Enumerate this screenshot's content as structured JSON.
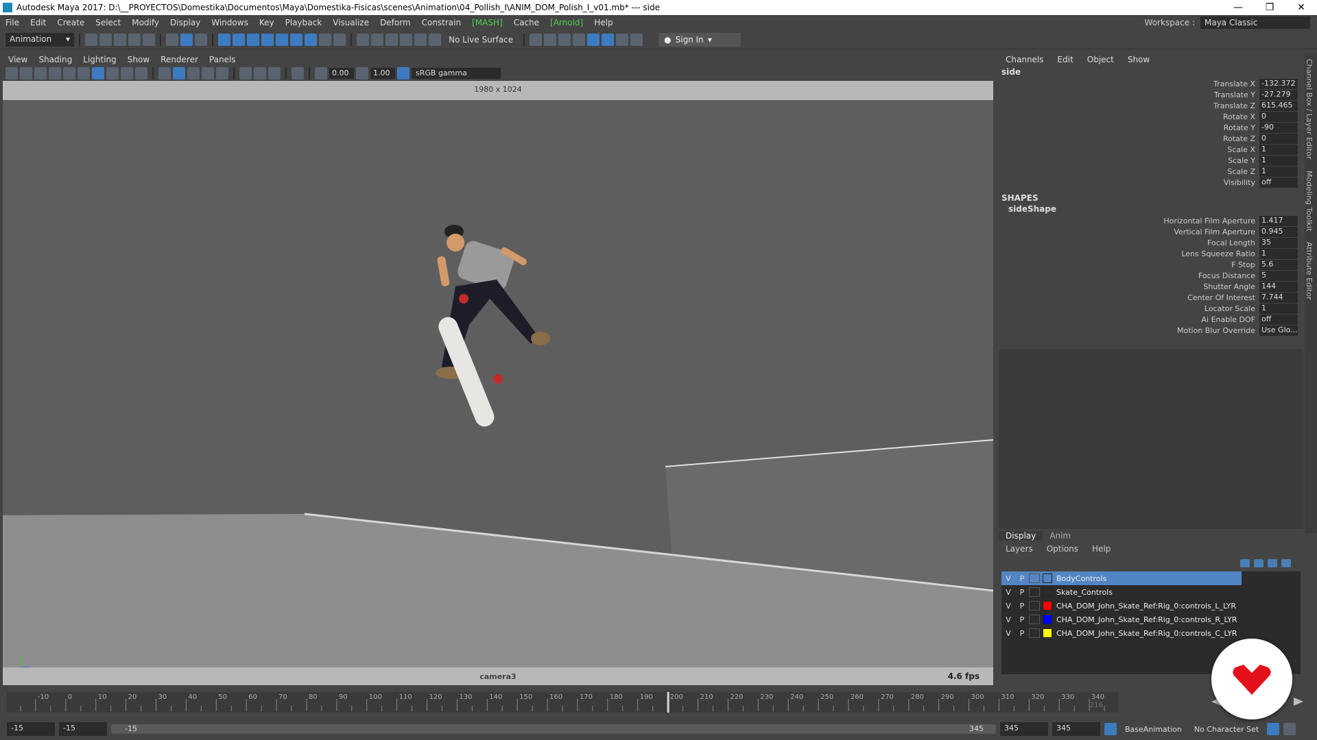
{
  "window": {
    "title": "Autodesk Maya 2017: D:\\__PROYECTOS\\Domestika\\Documentos\\Maya\\Domestika-Fisicas\\scenes\\Animation\\04_Pollish_I\\ANIM_DOM_Polish_I_v01.mb*   ---   side",
    "minimize": "—",
    "maximize": "❐",
    "close": "✕"
  },
  "menubar": {
    "items": [
      "File",
      "Edit",
      "Create",
      "Select",
      "Modify",
      "Display",
      "Windows",
      "Key",
      "Playback",
      "Visualize",
      "Deform",
      "Constrain",
      "[MASH]",
      "Cache",
      "[Arnold]",
      "Help"
    ],
    "workspace_label": "Workspace :",
    "workspace_value": "Maya Classic"
  },
  "toolbar": {
    "mode": "Animation",
    "live_surface": "No Live Surface",
    "sign_in": "Sign In"
  },
  "viewport": {
    "menu": [
      "View",
      "Shading",
      "Lighting",
      "Show",
      "Renderer",
      "Panels"
    ],
    "exposure": "0.00",
    "gamma": "1.00",
    "color_space": "sRGB gamma",
    "resolution": "1980 x 1024",
    "camera": "camera3",
    "fps": "4.6 fps"
  },
  "channel_box": {
    "menu": [
      "Channels",
      "Edit",
      "Object",
      "Show"
    ],
    "node": "side",
    "attributes": [
      {
        "name": "Translate X",
        "value": "-132.372"
      },
      {
        "name": "Translate Y",
        "value": "-27.279"
      },
      {
        "name": "Translate Z",
        "value": "615.465"
      },
      {
        "name": "Rotate X",
        "value": "0"
      },
      {
        "name": "Rotate Y",
        "value": "-90"
      },
      {
        "name": "Rotate Z",
        "value": "0"
      },
      {
        "name": "Scale X",
        "value": "1"
      },
      {
        "name": "Scale Y",
        "value": "1"
      },
      {
        "name": "Scale Z",
        "value": "1"
      },
      {
        "name": "Visibility",
        "value": "off"
      }
    ],
    "shapes_header": "SHAPES",
    "shape_node": "sideShape",
    "shape_attributes": [
      {
        "name": "Horizontal Film Aperture",
        "value": "1.417"
      },
      {
        "name": "Vertical Film Aperture",
        "value": "0.945"
      },
      {
        "name": "Focal Length",
        "value": "35"
      },
      {
        "name": "Lens Squeeze Ratio",
        "value": "1"
      },
      {
        "name": "F Stop",
        "value": "5.6"
      },
      {
        "name": "Focus Distance",
        "value": "5"
      },
      {
        "name": "Shutter Angle",
        "value": "144"
      },
      {
        "name": "Center Of Interest",
        "value": "7.744"
      },
      {
        "name": "Locator Scale",
        "value": "1"
      },
      {
        "name": "Ai Enable DOF",
        "value": "off"
      },
      {
        "name": "Motion Blur Override",
        "value": "Use Glo..."
      }
    ]
  },
  "layer_editor": {
    "tabs": [
      "Display",
      "Anim"
    ],
    "menu": [
      "Layers",
      "Options",
      "Help"
    ],
    "layers": [
      {
        "v": "V",
        "p": "P",
        "color": "",
        "name": "BodyControls",
        "selected": true
      },
      {
        "v": "V",
        "p": "P",
        "color": "",
        "name": "Skate_Controls",
        "selected": false
      },
      {
        "v": "V",
        "p": "P",
        "color": "#ff0000",
        "name": "CHA_DOM_John_Skate_Ref:Rig_0:controls_L_LYR",
        "selected": false
      },
      {
        "v": "V",
        "p": "P",
        "color": "#0000ff",
        "name": "CHA_DOM_John_Skate_Ref:Rig_0:controls_R_LYR",
        "selected": false
      },
      {
        "v": "V",
        "p": "P",
        "color": "#ffff00",
        "name": "CHA_DOM_John_Skate_Ref:Rig_0:controls_C_LYR",
        "selected": false
      }
    ]
  },
  "side_tabs": [
    "Channel Box / Layer Editor",
    "Modeling Toolkit",
    "Attribute Editor"
  ],
  "timeline": {
    "ticks": [
      "-10",
      "0",
      "10",
      "20",
      "30",
      "40",
      "50",
      "60",
      "70",
      "80",
      "90",
      "100",
      "110",
      "120",
      "130",
      "140",
      "150",
      "160",
      "170",
      "180",
      "190",
      "200",
      "210",
      "220",
      "230",
      "240",
      "250",
      "260",
      "270",
      "280",
      "290",
      "300",
      "310",
      "320",
      "330",
      "340"
    ],
    "current_frame": "216",
    "start": -15,
    "end": 345,
    "playhead": 200
  },
  "range": {
    "start_a": "-15",
    "start_b": "-15",
    "slider_start": "-15",
    "slider_end": "345",
    "end_a": "345",
    "end_b": "345",
    "anim_layer": "BaseAnimation",
    "char_set": "No Character Set"
  }
}
